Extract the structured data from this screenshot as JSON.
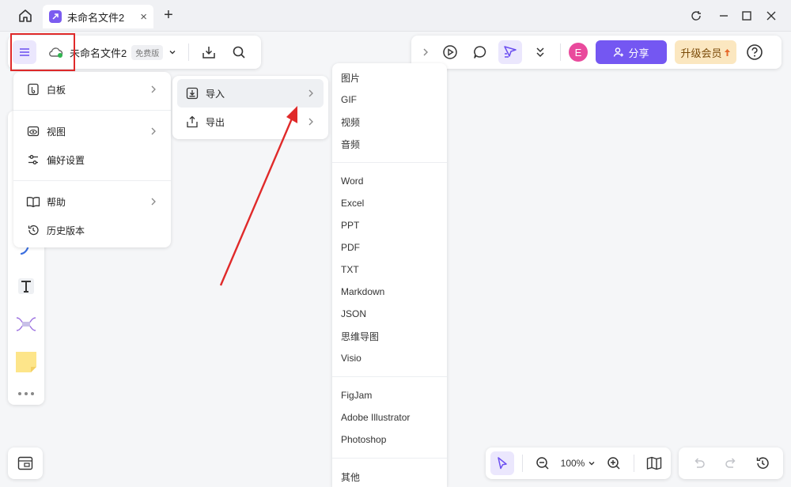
{
  "window": {
    "tab_title": "未命名文件2",
    "tab_close": "×",
    "new_tab": "+"
  },
  "toolbar": {
    "doc_name": "未命名文件2",
    "plan_badge": "免费版",
    "avatar_letter": "E",
    "share_label": "分享",
    "upgrade_label": "升级会员"
  },
  "main_menu": {
    "items": [
      {
        "label": "白板",
        "icon": "whiteboard-icon",
        "submenu": true
      },
      {
        "label": "视图",
        "icon": "eye-icon",
        "submenu": true
      },
      {
        "label": "偏好设置",
        "icon": "sliders-icon",
        "submenu": false
      },
      {
        "label": "帮助",
        "icon": "book-icon",
        "submenu": true
      },
      {
        "label": "历史版本",
        "icon": "history-icon",
        "submenu": false
      }
    ]
  },
  "whiteboard_submenu": {
    "items": [
      {
        "label": "导入",
        "icon": "import-icon",
        "active": true
      },
      {
        "label": "导出",
        "icon": "export-icon",
        "active": false
      }
    ]
  },
  "import_menu": {
    "group_media": [
      "图片",
      "GIF",
      "视频",
      "音频"
    ],
    "group_docs": [
      "Word",
      "Excel",
      "PPT",
      "PDF",
      "TXT",
      "Markdown",
      "JSON",
      "思维导图",
      "Visio"
    ],
    "group_design": [
      "FigJam",
      "Adobe Illustrator",
      "Photoshop"
    ],
    "group_other": [
      "其他"
    ]
  },
  "zoom": {
    "value": "100%"
  },
  "colors": {
    "accent": "#7457f2",
    "highlight_box": "#e02a2a",
    "arrow": "#e02a2a",
    "avatar": "#e94a9c",
    "upgrade_bg": "#fbe7c0"
  }
}
